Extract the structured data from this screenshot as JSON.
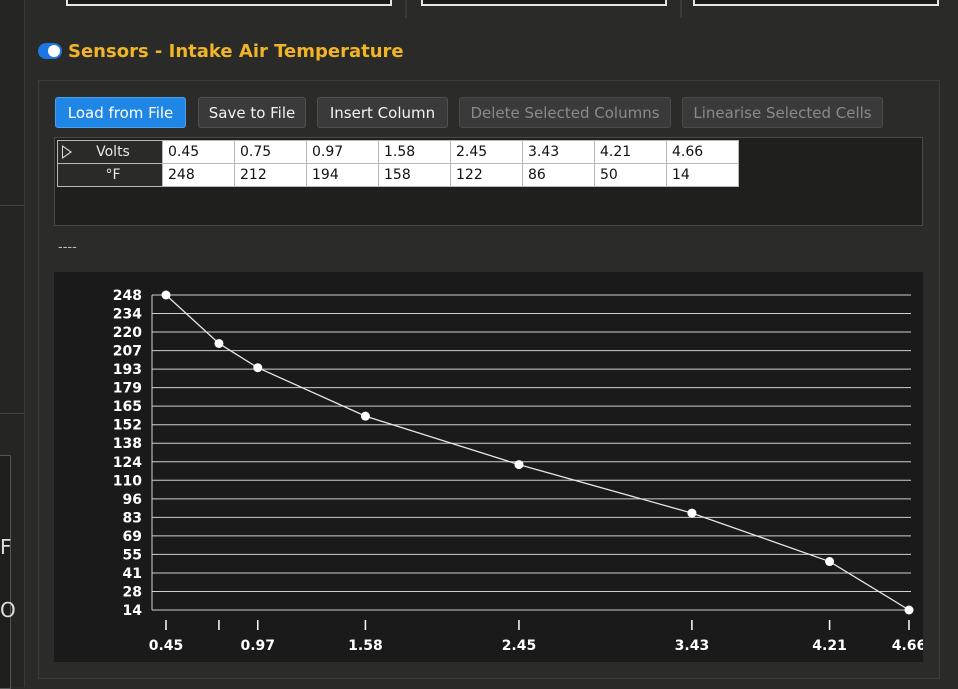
{
  "background_tabs": {
    "left_glyph_1": "F",
    "left_glyph_2": "O"
  },
  "panel": {
    "title": "Sensors - Intake Air Temperature",
    "toggle_on": true,
    "accent_color": "#f0b429",
    "toggle_color": "#1c78e0"
  },
  "toolbar": {
    "load_label": "Load from File",
    "save_label": "Save to File",
    "insert_label": "Insert Column",
    "delete_label": "Delete Selected Columns",
    "linearise_label": "Linearise Selected Cells"
  },
  "table": {
    "row_headers": [
      "Volts",
      "°F"
    ],
    "volts": [
      "0.45",
      "0.75",
      "0.97",
      "1.58",
      "2.45",
      "3.43",
      "4.21",
      "4.66"
    ],
    "temps": [
      "248",
      "212",
      "194",
      "158",
      "122",
      "86",
      "50",
      "14"
    ]
  },
  "status_text": "----",
  "chart_data": {
    "type": "line",
    "x": [
      0.45,
      0.75,
      0.97,
      1.58,
      2.45,
      3.43,
      4.21,
      4.66
    ],
    "y": [
      248,
      212,
      194,
      158,
      122,
      86,
      50,
      14
    ],
    "xlim": [
      0.45,
      4.66
    ],
    "ylim": [
      14,
      248
    ],
    "x_tick_labels": [
      "0.45",
      "",
      "0.97",
      "1.58",
      "2.45",
      "3.43",
      "4.21",
      "4.66"
    ],
    "y_tick_labels": [
      "248",
      "234",
      "220",
      "207",
      "193",
      "179",
      "165",
      "152",
      "138",
      "124",
      "110",
      "96",
      "83",
      "69",
      "55",
      "41",
      "28",
      "14"
    ],
    "grid": true,
    "line_color": "#e6e6e6",
    "title": "",
    "xlabel": "",
    "ylabel": ""
  }
}
